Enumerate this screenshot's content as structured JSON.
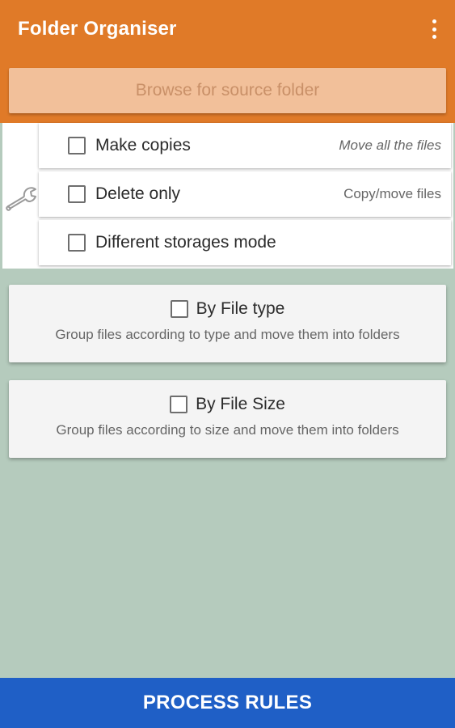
{
  "appbar": {
    "title": "Folder Organiser",
    "menu_icon": "overflow-menu-icon"
  },
  "browse": {
    "label": "Browse for source folder"
  },
  "options": {
    "icon": "wrench-icon",
    "rows": [
      {
        "label": "Make copies",
        "hint": "Move all the files",
        "checked": false
      },
      {
        "label": "Delete only",
        "hint": "Copy/move files",
        "checked": false
      },
      {
        "label": "Different storages mode",
        "hint": "",
        "checked": false
      }
    ]
  },
  "cards": [
    {
      "title": "By File type",
      "description": "Group files according to type and move them into folders",
      "checked": false
    },
    {
      "title": "By File Size",
      "description": "Group files according to size and move them into folders",
      "checked": false
    }
  ],
  "footer": {
    "process_label": "PROCESS RULES"
  },
  "colors": {
    "primary": "#e07a28",
    "background": "#b5cbbd",
    "action": "#1f5fc6"
  }
}
